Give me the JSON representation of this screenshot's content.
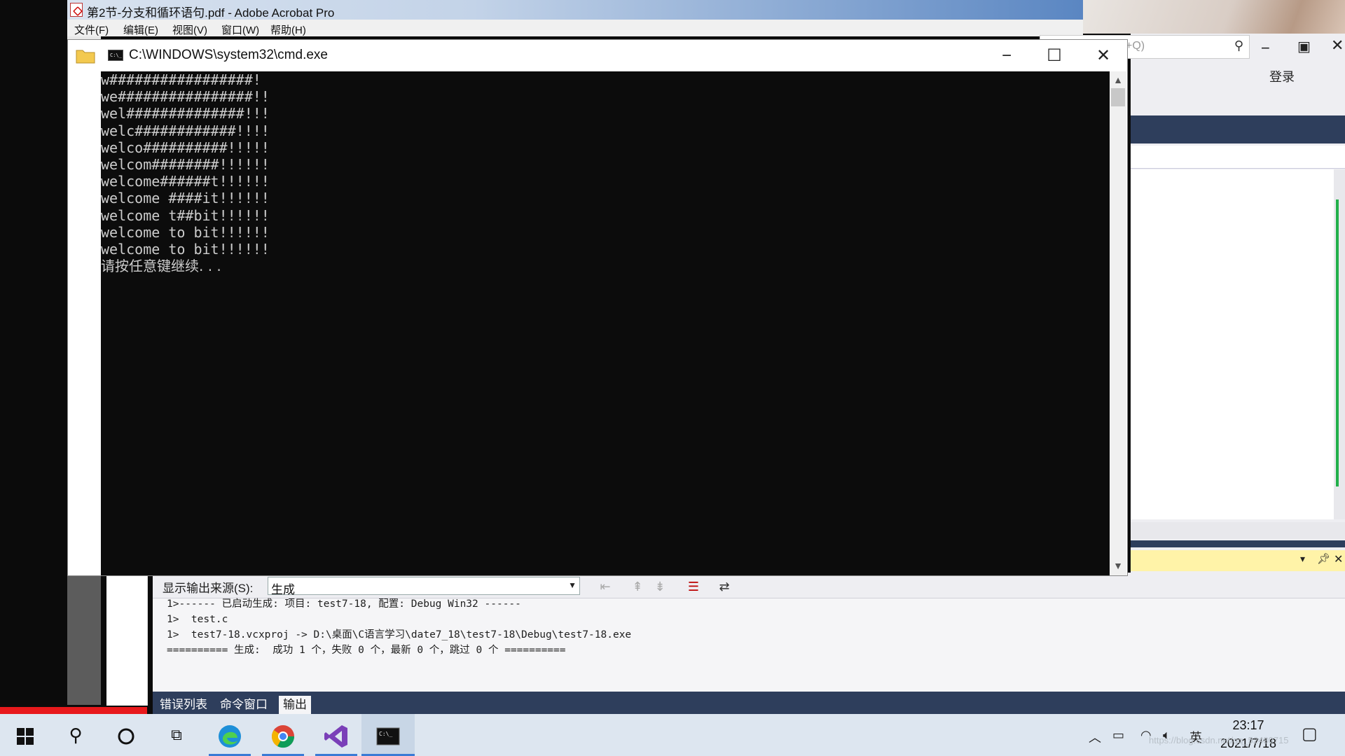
{
  "acrobat": {
    "title": "第2节-分支和循环语句.pdf - Adobe Acrobat Pro",
    "menu": [
      "文件(F)",
      "编辑(E)",
      "视图(V)",
      "窗口(W)",
      "帮助(H)"
    ]
  },
  "vs": {
    "search_hint": "+Q)",
    "login": "登录",
    "output": {
      "source_label": "显示输出来源(S):",
      "source_value": "生成",
      "lines": [
        "1>------ 已启动生成: 项目: test7-18, 配置: Debug Win32 ------",
        "1>  test.c",
        "1>  test7-18.vcxproj -> D:\\桌面\\C语言学习\\date7_18\\test7-18\\Debug\\test7-18.exe",
        "========== 生成:  成功 1 个，失败 0 个，最新 0 个，跳过 0 个 =========="
      ]
    },
    "tabs": [
      "错误列表",
      "命令窗口",
      "输出"
    ],
    "active_tab": "输出"
  },
  "cmd": {
    "title": "C:\\WINDOWS\\system32\\cmd.exe",
    "lines": [
      "w#################!",
      "we################!!",
      "wel##############!!!",
      "welc############!!!!",
      "welco##########!!!!!",
      "welcom########!!!!!!",
      "welcome######t!!!!!!",
      "welcome ####it!!!!!!",
      "welcome t##bit!!!!!!",
      "welcome to bit!!!!!!",
      "welcome to bit!!!!!!"
    ],
    "prompt": "请按任意键继续. . ."
  },
  "taskbar": {
    "time": "23:17",
    "date": "2021/7/18",
    "ime": "英",
    "watermark": "https://blog.csdn.net/qq_52480715"
  },
  "colors": {
    "cmd_bg": "#0c0c0c",
    "cmd_fg": "#cccccc",
    "vs_navy": "#2e3e5c",
    "taskbar": "#dde6f0"
  }
}
